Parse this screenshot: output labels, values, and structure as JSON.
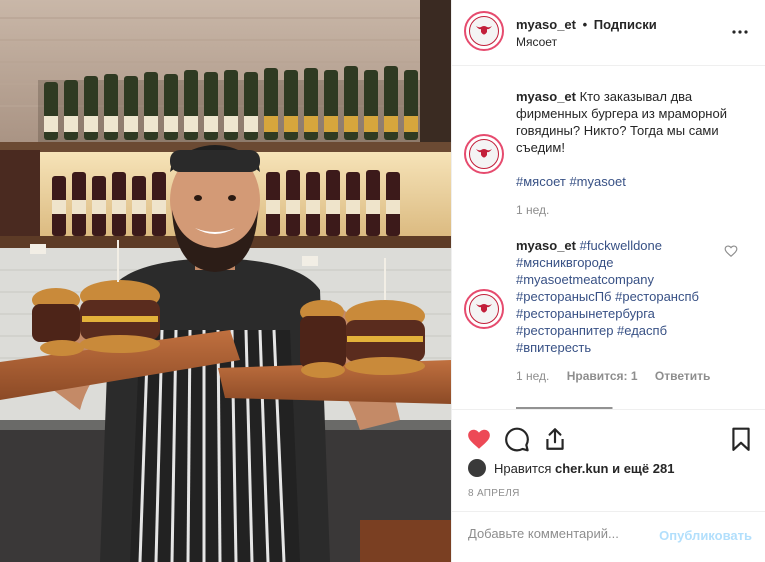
{
  "post": {
    "photo_alt": "",
    "header": {
      "username": "myaso_et",
      "separator": "•",
      "follow_label": "Подписки",
      "subtitle": "Мясоет",
      "more_icon": "more-horizontal-icon"
    },
    "caption": {
      "username": "myaso_et",
      "text": "Кто заказывал два фирменных бургера из мраморной говядины? Никто? Тогда мы сами съедим!",
      "hashtags": "#мясоет #myasoet",
      "time": "1 нед."
    },
    "comment": {
      "username": "myaso_et",
      "first_tag": "#fuckwelldone",
      "tags": [
        "#мясниквгороде",
        "#myasoetmeatcompany",
        "#ресторанысПб #ресторанспб",
        "#ресторанынетербурга",
        "#ресторанпитер #едаспб",
        "#впитересть"
      ],
      "time": "1 нед.",
      "likes": "Нравится: 1",
      "reply": "Ответить"
    },
    "actions": {
      "like_icon": "heart-filled-icon",
      "comment_icon": "comment-icon",
      "share_icon": "share-icon",
      "save_icon": "bookmark-icon",
      "like_color": "#ed4956"
    },
    "likes": {
      "prefix": "Нравится",
      "user": "cher.kun",
      "suffix": "и ещё 281"
    },
    "date": "8 АПРЕЛЯ",
    "add_comment": {
      "placeholder": "Добавьте комментарий...",
      "post_label": "Опубликовать"
    }
  }
}
